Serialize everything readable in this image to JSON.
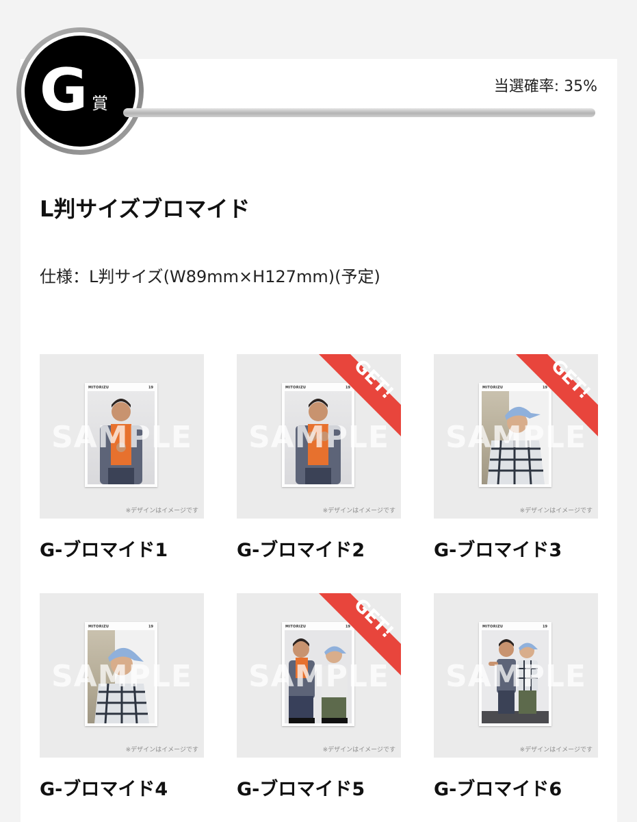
{
  "prize": {
    "letter": "G",
    "suffix": "賞",
    "probability": "当選確率: 35%",
    "title": "L判サイズブロマイド",
    "spec": "仕様：L判サイズ(W89mm×H127mm)(予定)"
  },
  "card": {
    "brand": "MITORIZU",
    "number": "19"
  },
  "watermark": "SAMPLE",
  "image_note": "※デザインはイメージです",
  "get_label": "GET!",
  "colors": {
    "ribbon": "#e8453c",
    "badge": "#000000",
    "thumb_bg": "#ebebeb"
  },
  "items": [
    {
      "name": "G-ブロマイド1",
      "got": false,
      "subject": "single-man-hoodie"
    },
    {
      "name": "G-ブロマイド2",
      "got": true,
      "subject": "single-man-hoodie-hands"
    },
    {
      "name": "G-ブロマイド3",
      "got": true,
      "subject": "single-man-cap-profile"
    },
    {
      "name": "G-ブロマイド4",
      "got": false,
      "subject": "single-man-cap-side"
    },
    {
      "name": "G-ブロマイド5",
      "got": true,
      "subject": "duo-crouching"
    },
    {
      "name": "G-ブロマイド6",
      "got": false,
      "subject": "duo-standing"
    }
  ]
}
